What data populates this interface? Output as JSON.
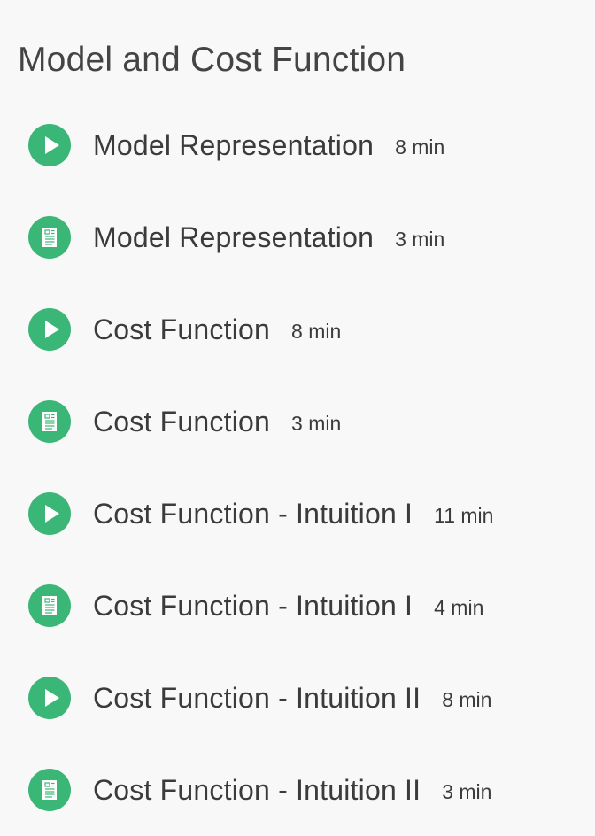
{
  "section": {
    "title": "Model and Cost Function"
  },
  "colors": {
    "accent": "#3ab776",
    "background": "#f8f8f8",
    "text": "#3b3b3b"
  },
  "items": [
    {
      "type": "video",
      "icon": "play-icon",
      "title": "Model Representation",
      "duration": "8 min"
    },
    {
      "type": "reading",
      "icon": "document-icon",
      "title": "Model Representation",
      "duration": "3 min"
    },
    {
      "type": "video",
      "icon": "play-icon",
      "title": "Cost Function",
      "duration": "8 min"
    },
    {
      "type": "reading",
      "icon": "document-icon",
      "title": "Cost Function",
      "duration": "3 min"
    },
    {
      "type": "video",
      "icon": "play-icon",
      "title": "Cost Function - Intuition I",
      "duration": "11 min"
    },
    {
      "type": "reading",
      "icon": "document-icon",
      "title": "Cost Function - Intuition I",
      "duration": "4 min"
    },
    {
      "type": "video",
      "icon": "play-icon",
      "title": "Cost Function - Intuition II",
      "duration": "8 min"
    },
    {
      "type": "reading",
      "icon": "document-icon",
      "title": "Cost Function - Intuition II",
      "duration": "3 min"
    }
  ]
}
